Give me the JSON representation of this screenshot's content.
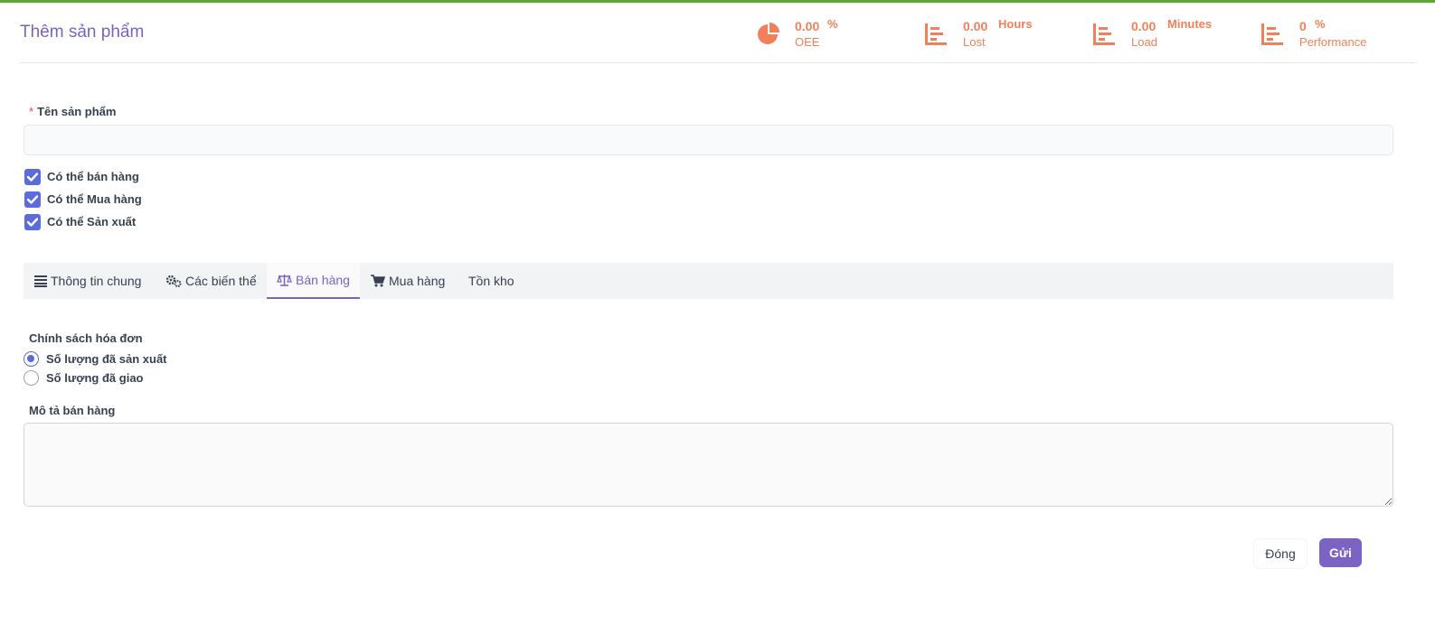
{
  "page": {
    "title": "Thêm sản phẩm"
  },
  "kpis": [
    {
      "icon": "pie-chart-icon",
      "value": "0.00",
      "unit": "%",
      "label": "OEE"
    },
    {
      "icon": "bar-chart-icon",
      "value": "0.00",
      "unit": "Hours",
      "label": "Lost"
    },
    {
      "icon": "bar-chart-icon",
      "value": "0.00",
      "unit": "Minutes",
      "label": "Load"
    },
    {
      "icon": "bar-chart-icon",
      "value": "0",
      "unit": "%",
      "label": "Performance"
    }
  ],
  "form": {
    "name_label": "Tên sản phẩm",
    "required_mark": "*",
    "name_value": "",
    "checkboxes": [
      {
        "label": "Có thể bán hàng",
        "checked": true
      },
      {
        "label": "Có thể Mua hàng",
        "checked": true
      },
      {
        "label": "Có thể Sản xuất",
        "checked": true
      }
    ]
  },
  "tabs": [
    {
      "label": "Thông tin chung",
      "icon": "list-icon",
      "active": false
    },
    {
      "label": "Các biến thể",
      "icon": "gears-icon",
      "active": false
    },
    {
      "label": "Bán hàng",
      "icon": "balance-scale-icon",
      "active": true
    },
    {
      "label": "Mua hàng",
      "icon": "cart-icon",
      "active": false
    },
    {
      "label": "Tồn kho",
      "icon": "",
      "active": false
    }
  ],
  "sales": {
    "invoice_policy_label": "Chính sách hóa đơn",
    "options": [
      {
        "label": "Số lượng đã sản xuất",
        "selected": true
      },
      {
        "label": "Số lượng đã giao",
        "selected": false
      }
    ],
    "description_label": "Mô tả bán hàng",
    "description_value": ""
  },
  "actions": {
    "close_label": "Đóng",
    "submit_label": "Gửi"
  },
  "colors": {
    "accent": "#7a63c2",
    "kpi": "#f0805a",
    "checkbox": "#5b6bdc",
    "top_stripe": "#5aa832"
  }
}
